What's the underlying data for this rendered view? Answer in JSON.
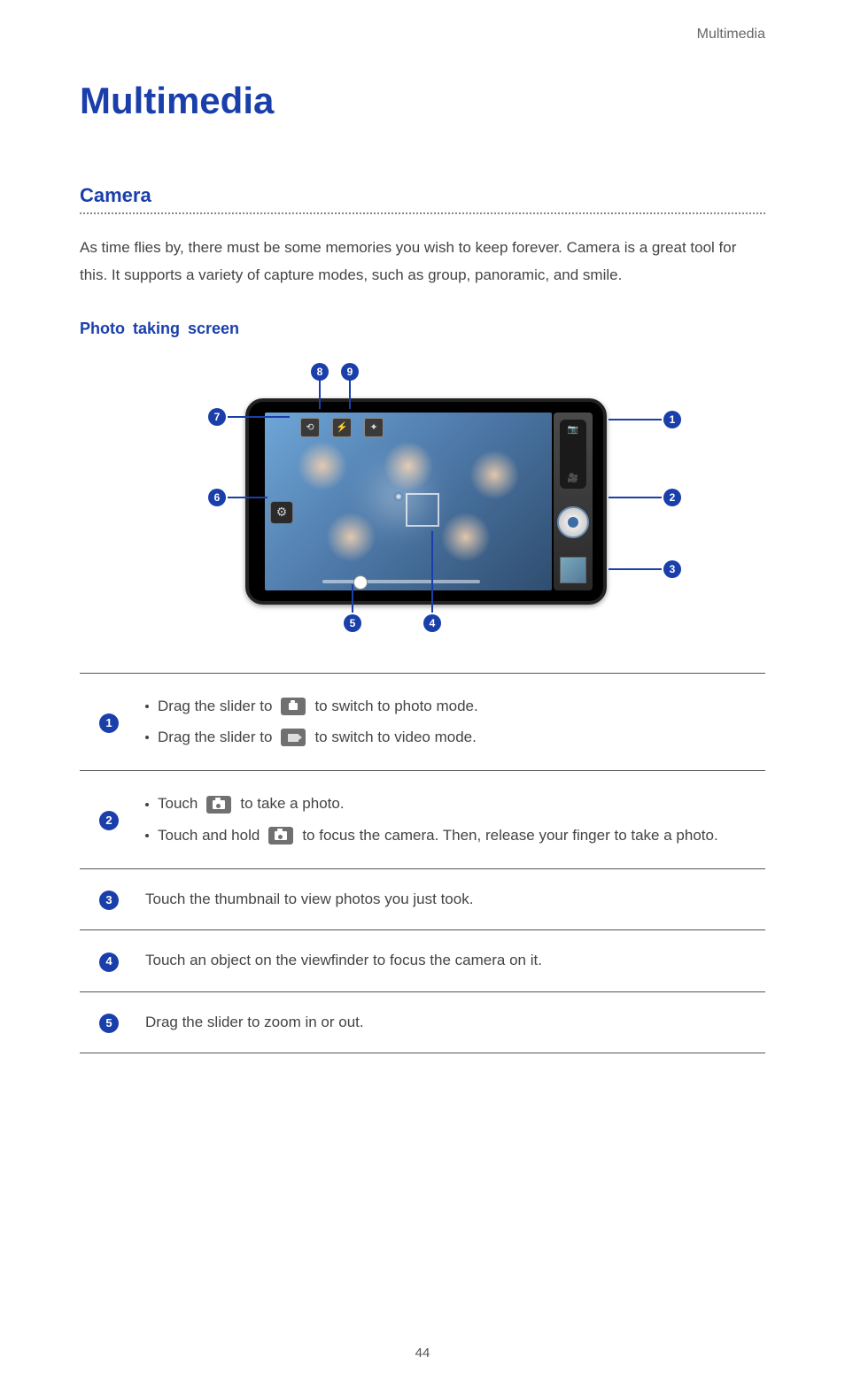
{
  "header": {
    "section_label": "Multimedia"
  },
  "title": "Multimedia",
  "camera": {
    "heading": "Camera",
    "intro": "As time flies by, there must be some memories you wish to keep forever. Camera is a great tool for this. It supports a variety of capture modes, such as group, panoramic, and smile.",
    "subheading": "Photo taking screen"
  },
  "diagram_callouts": [
    "1",
    "2",
    "3",
    "4",
    "5",
    "6",
    "7",
    "8",
    "9"
  ],
  "table": {
    "rows": [
      {
        "num": "1",
        "lines": [
          {
            "prefix": "Drag the slider to",
            "icon": "photo-mode-chip",
            "suffix": "to switch to photo mode."
          },
          {
            "prefix": "Drag the slider to",
            "icon": "video-mode-chip",
            "suffix": "to switch to video mode."
          }
        ]
      },
      {
        "num": "2",
        "lines": [
          {
            "prefix": "Touch",
            "icon": "shutter-chip",
            "suffix": "to take a photo."
          },
          {
            "prefix": "Touch and hold",
            "icon": "shutter-chip",
            "suffix": "to focus the camera. Then, release your finger to take a photo."
          }
        ]
      },
      {
        "num": "3",
        "text": "Touch the thumbnail to view photos you just took."
      },
      {
        "num": "4",
        "text": "Touch an object on the viewfinder to focus the camera on it."
      },
      {
        "num": "5",
        "text": "Drag the slider to zoom in or out."
      }
    ]
  },
  "page_number": "44"
}
